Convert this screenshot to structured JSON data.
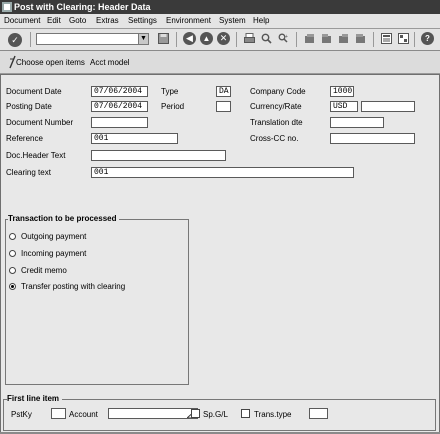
{
  "window": {
    "title": "Post with Clearing: Header Data"
  },
  "menu": [
    "Document",
    "Edit",
    "Goto",
    "Extras",
    "Settings",
    "Environment",
    "System",
    "Help"
  ],
  "toolbar": {
    "command_field": "",
    "icons": [
      "check-icon",
      "save-icon",
      "back-icon",
      "exit-icon",
      "cancel-icon",
      "print-icon",
      "find-icon",
      "find-next-icon",
      "first-page-icon",
      "previous-page-icon",
      "next-page-icon",
      "last-page-icon",
      "create-session-icon",
      "shortcut-icon",
      "help-icon"
    ]
  },
  "app_toolbar": {
    "choose_open_items": "Choose open items",
    "acct_model": "Acct model"
  },
  "header": {
    "document_date": {
      "label": "Document Date",
      "value": "07/06/2004"
    },
    "type": {
      "label": "Type",
      "value": "DA"
    },
    "company_code": {
      "label": "Company Code",
      "value": "1000"
    },
    "posting_date": {
      "label": "Posting Date",
      "value": "07/06/2004"
    },
    "period": {
      "label": "Period",
      "value": ""
    },
    "currency_rate": {
      "label": "Currency/Rate",
      "value": "USD",
      "rate": ""
    },
    "document_number": {
      "label": "Document Number",
      "value": ""
    },
    "translation_date": {
      "label": "Translation dte",
      "value": ""
    },
    "reference": {
      "label": "Reference",
      "value": "001"
    },
    "cross_cc": {
      "label": "Cross-CC no.",
      "value": ""
    },
    "doc_header_text": {
      "label": "Doc.Header Text",
      "value": ""
    },
    "clearing_text": {
      "label": "Clearing text",
      "value": "001"
    }
  },
  "transaction": {
    "title": "Transaction to be processed",
    "options": [
      "Outgoing payment",
      "Incoming payment",
      "Credit memo",
      "Transfer posting with clearing"
    ],
    "selected": 3
  },
  "first_line_item": {
    "title": "First line item",
    "pstky_label": "PstKy",
    "pstky": "",
    "account_label": "Account",
    "account": "",
    "spgl_label": "Sp.G/L",
    "transtype_label": "Trans.type",
    "transtype": ""
  }
}
